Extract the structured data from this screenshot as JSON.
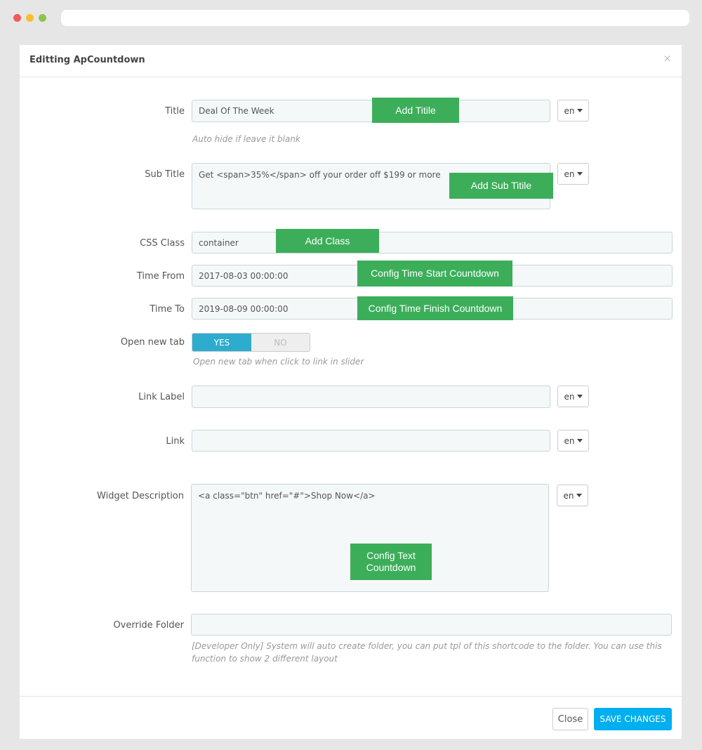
{
  "modal": {
    "title": "Editting ApCountdown",
    "close_icon": "×"
  },
  "fields": {
    "title": {
      "label": "Title",
      "value": "Deal Of The Week",
      "help": "Auto hide if leave it blank",
      "lang": "en"
    },
    "sub_title": {
      "label": "Sub Title",
      "value": "Get <span>35%</span> off  your order off $199 or more",
      "lang": "en"
    },
    "css_class": {
      "label": "CSS Class",
      "value": "container"
    },
    "time_from": {
      "label": "Time From",
      "value": "2017-08-03 00:00:00"
    },
    "time_to": {
      "label": "Time To",
      "value": "2019-08-09 00:00:00"
    },
    "open_new_tab": {
      "label": "Open new tab",
      "yes": "YES",
      "no": "NO",
      "selected": "YES",
      "help": "Open new tab when click to link in slider"
    },
    "link_label": {
      "label": "Link Label",
      "value": "",
      "lang": "en"
    },
    "link": {
      "label": "Link",
      "value": "",
      "lang": "en"
    },
    "widget_description": {
      "label": "Widget Description",
      "value": "<a class=\"btn\" href=\"#\">Shop Now</a>",
      "lang": "en"
    },
    "override_folder": {
      "label": "Override Folder",
      "value": "",
      "help": "[Developer Only] System will auto create folder, you can put tpl of this shortcode to the folder. You can use this function to show 2 different layout"
    }
  },
  "annotations": {
    "title": "Add Titile",
    "sub_title": "Add Sub Titile",
    "css_class": "Add Class",
    "time_from": "Config Time Start Countdown",
    "time_to": "Config Time Finish Countdown",
    "description": "Config Text Countdown"
  },
  "footer": {
    "close_label": "Close",
    "save_label": "SAVE CHANGES"
  },
  "colors": {
    "annotation_bg": "#3cae5a",
    "toggle_active": "#2eacce",
    "save_button": "#00aff0"
  }
}
